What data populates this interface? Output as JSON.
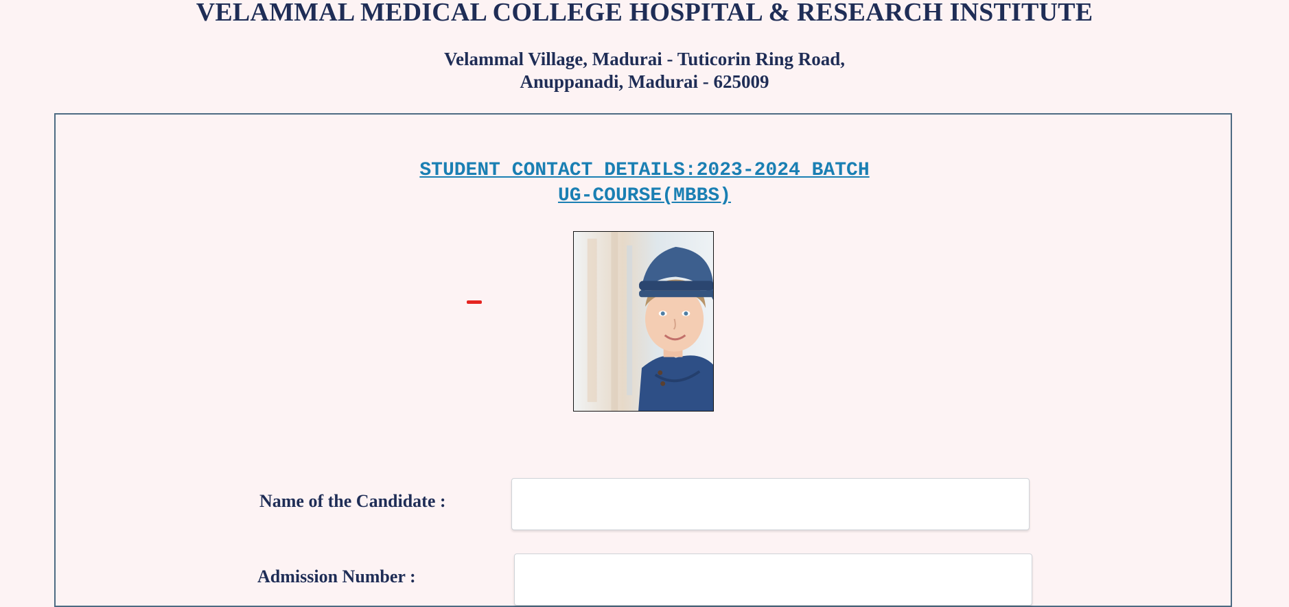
{
  "header": {
    "institute_name": "VELAMMAL MEDICAL COLLEGE HOSPITAL & RESEARCH INSTITUTE",
    "address_line1": "Velammal Village, Madurai - Tuticorin Ring Road,",
    "address_line2": "Anuppanadi, Madurai - 625009"
  },
  "form": {
    "heading_line1": "STUDENT CONTACT DETAILS:2023-2024 BATCH",
    "heading_line2": "UG-COURSE(MBBS)",
    "photo_alt": "student-photo",
    "fields": [
      {
        "label": "Name of the Candidate :",
        "value": "",
        "placeholder": ""
      },
      {
        "label": "Admission Number :",
        "value": "",
        "placeholder": ""
      }
    ]
  },
  "colors": {
    "background": "#fdf3f4",
    "heading_text": "#1f2d56",
    "form_heading": "#1a7fb3",
    "frame_border": "#4d6a82",
    "marker": "#e52420"
  }
}
